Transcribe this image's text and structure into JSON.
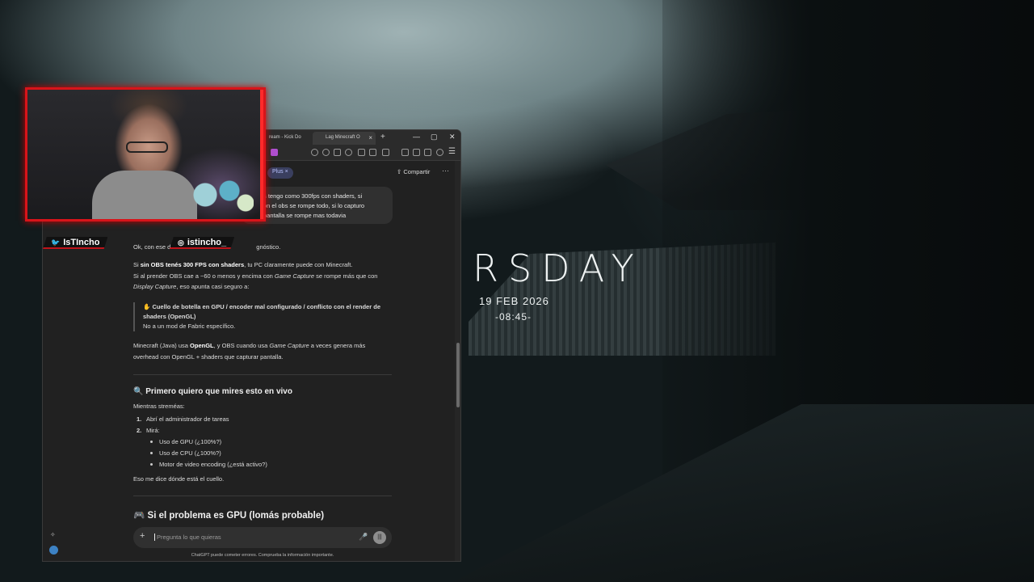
{
  "desktop": {
    "clock_word": "RSDAY",
    "date": "19 FEB 2026",
    "time": "-08:45-"
  },
  "browser": {
    "tabs": [
      {
        "label": "ream - Kick Do"
      },
      {
        "label": "Lag Minecraft O"
      }
    ],
    "model_badge": "Plus",
    "share_label": "Compartir"
  },
  "chat": {
    "user_message": [
      "s tengo como 300fps con shaders, si",
      "on el obs se rompe todo, si lo capturo",
      "pantalla se rompe mas todavia"
    ],
    "intro_start": "Ok, con ese d",
    "intro_end": "gnóstico.",
    "p1_pre": "Si ",
    "p1_bold": "sin OBS tenés 300 FPS con shaders",
    "p1_post": ", tu PC claramente puede con Minecraft.",
    "p2a": "Si al prender OBS cae a ~60 o menos y encima con ",
    "p2b": "Game Capture",
    "p2c": " se rompe más que con",
    "p2d": "Display Capture",
    "p2e": ", eso apunta casi seguro a:",
    "quote_bold": "Cuello de botella en GPU / encoder mal configurado / conflicto con el render de shaders (OpenGL)",
    "quote_line2": "No a un mod de Fabric específico.",
    "p3a": "Minecraft (Java) usa ",
    "p3b": "OpenGL",
    "p3c": ", y OBS cuando usa ",
    "p3d": "Game Capture",
    "p3e": " a veces genera más",
    "p3f": "overhead con OpenGL + shaders que capturar pantalla.",
    "h_live": "Primero quiero que mires esto en vivo",
    "streaming": "Mientras streméas:",
    "step1": "Abrí el administrador de tareas",
    "step2": "Mirá:",
    "check_gpu": "Uso de GPU (¿100%?)",
    "check_cpu": "Uso de CPU (¿100%?)",
    "check_enc": "Motor de video encoding (¿está activo?)",
    "conclusion": "Eso me dice dónde está el cuello.",
    "h_gpu_a": "Si el problema es GPU (lo",
    "h_gpu_b": "más probable)",
    "input_placeholder": "Pregunta lo que quieras",
    "footer": "ChatGPT puede cometer errores. Comprueba la información importante."
  },
  "overlay": {
    "twitter": "IsTIncho",
    "instagram": "istincho_"
  },
  "colors": {
    "frame": "#d8141a",
    "accent_badge": "#b8c2ff"
  }
}
